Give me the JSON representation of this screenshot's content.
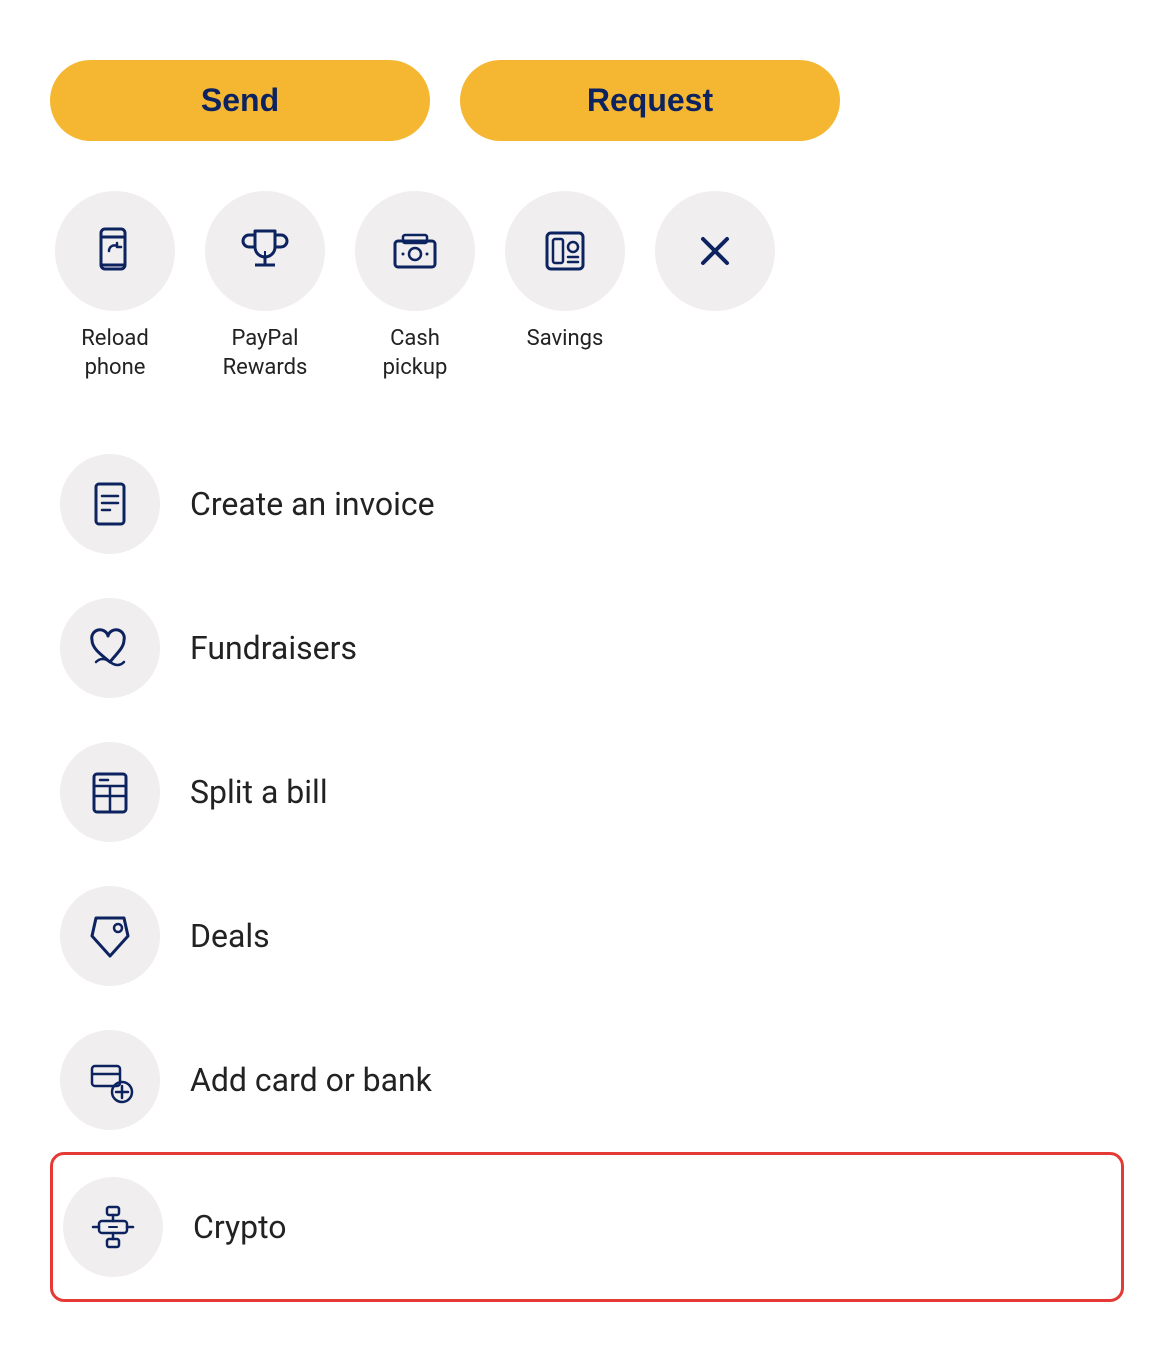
{
  "buttons": {
    "send": "Send",
    "request": "Request"
  },
  "quickActions": [
    {
      "id": "reload-phone",
      "label": "Reload\nphone",
      "icon": "reload-phone-icon"
    },
    {
      "id": "paypal-rewards",
      "label": "PayPal\nRewards",
      "icon": "trophy-icon"
    },
    {
      "id": "cash-pickup",
      "label": "Cash\npickup",
      "icon": "cash-pickup-icon"
    },
    {
      "id": "savings",
      "label": "Savings",
      "icon": "savings-icon"
    },
    {
      "id": "close",
      "label": "",
      "icon": "close-icon"
    }
  ],
  "listItems": [
    {
      "id": "create-invoice",
      "label": "Create an invoice",
      "icon": "invoice-icon",
      "highlighted": false
    },
    {
      "id": "fundraisers",
      "label": "Fundraisers",
      "icon": "fundraisers-icon",
      "highlighted": false
    },
    {
      "id": "split-bill",
      "label": "Split a bill",
      "icon": "split-bill-icon",
      "highlighted": false
    },
    {
      "id": "deals",
      "label": "Deals",
      "icon": "deals-icon",
      "highlighted": false
    },
    {
      "id": "add-card-bank",
      "label": "Add card or bank",
      "icon": "add-card-icon",
      "highlighted": false
    },
    {
      "id": "crypto",
      "label": "Crypto",
      "icon": "crypto-icon",
      "highlighted": true
    }
  ],
  "colors": {
    "brand_yellow": "#F5B731",
    "brand_navy": "#0d2360",
    "icon_bg": "#f0eeee",
    "highlight_border": "#e53935"
  }
}
